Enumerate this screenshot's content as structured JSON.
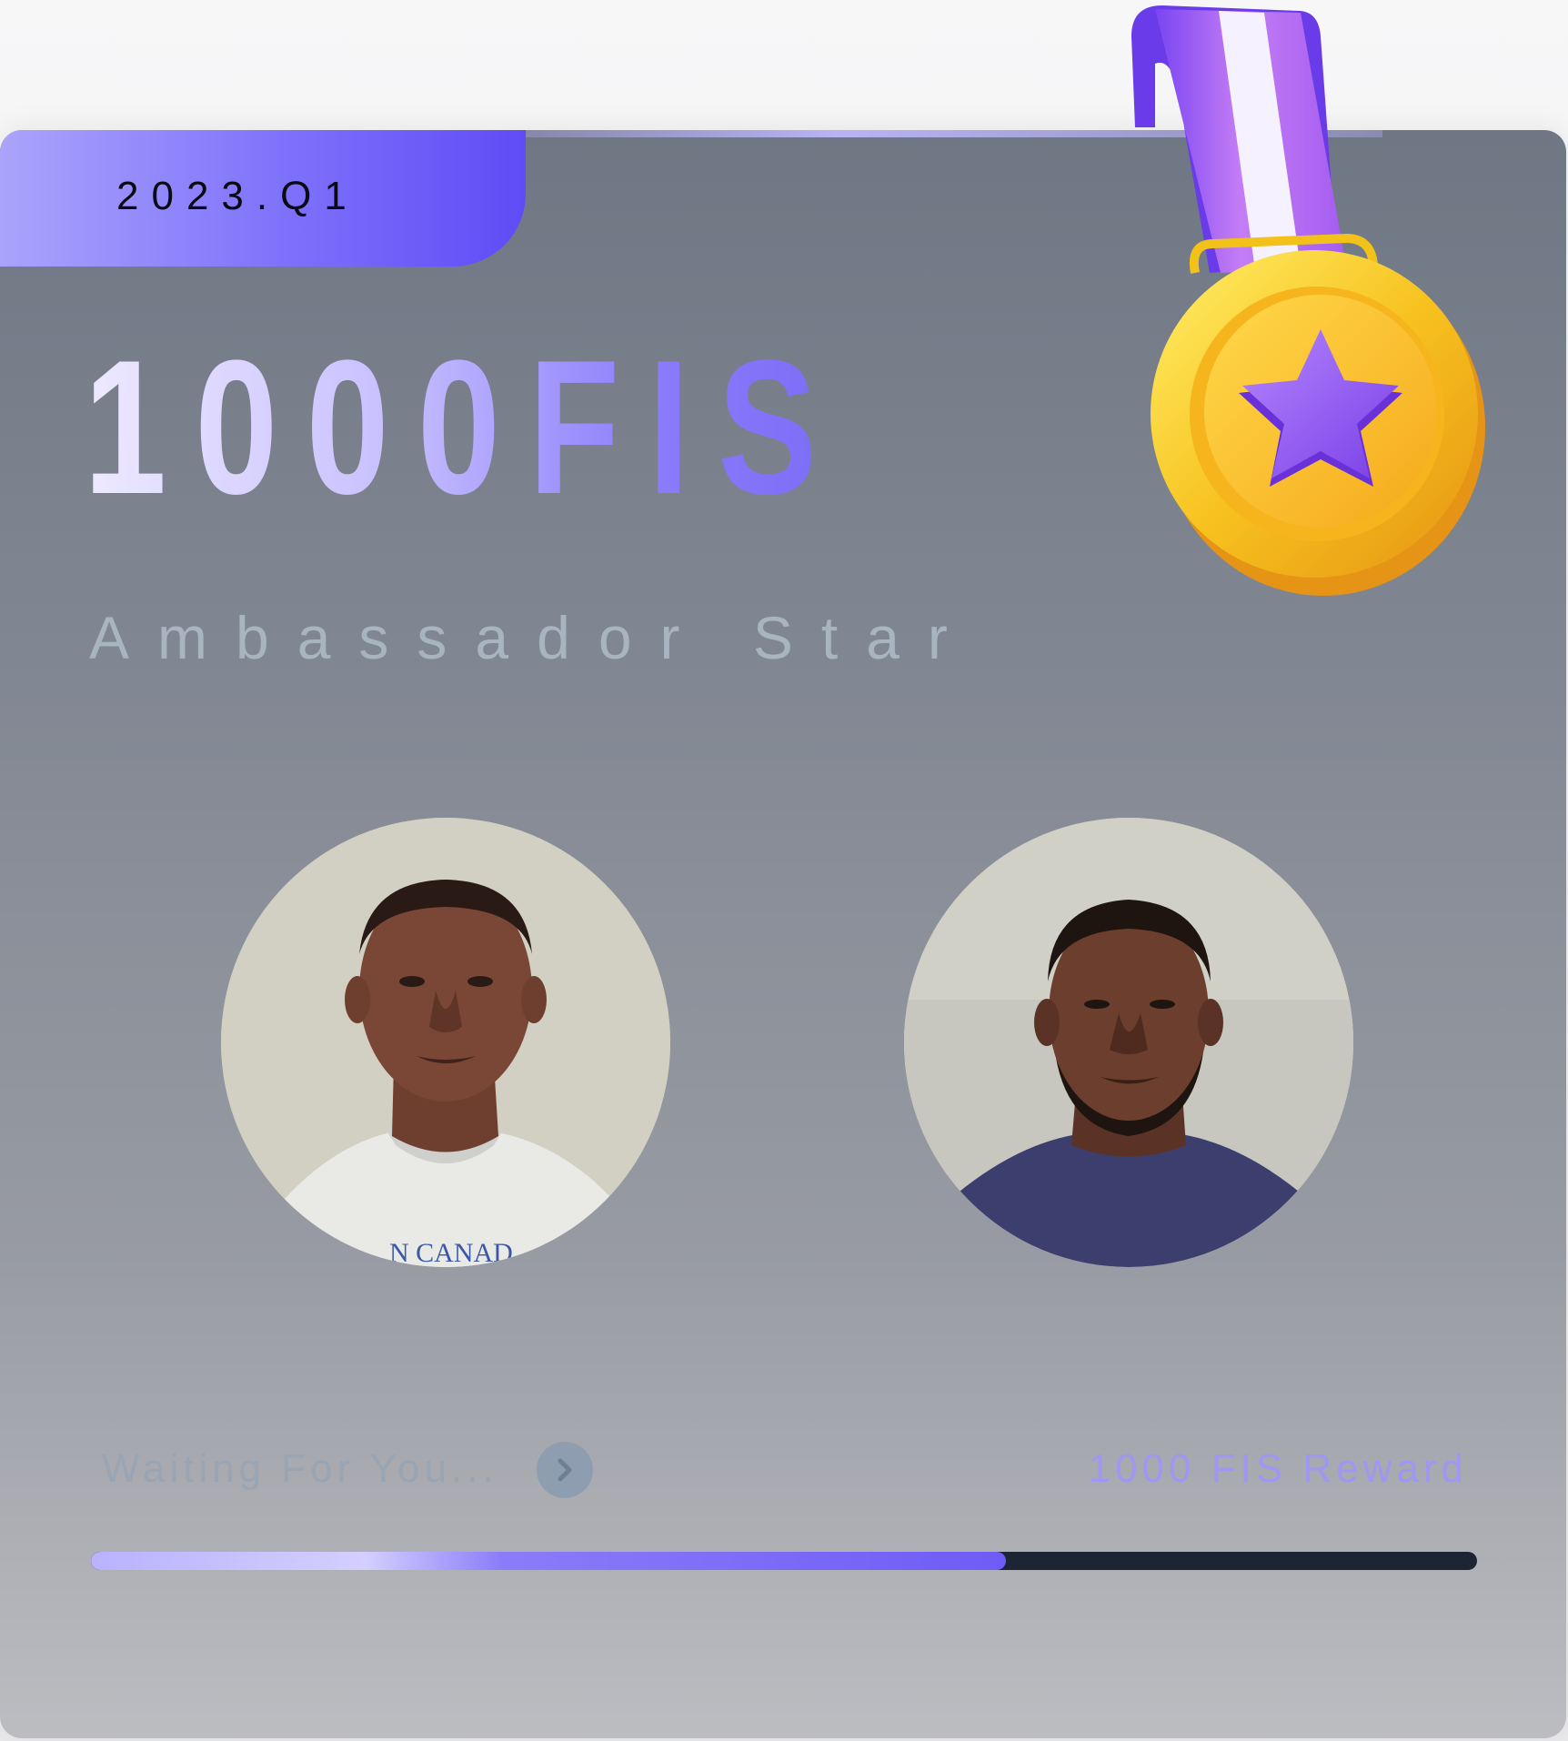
{
  "card": {
    "quarter": "2023.Q1",
    "headline": "1000FIS",
    "subtitle": "Ambassador Star"
  },
  "avatars": [
    {
      "name": "avatar-1"
    },
    {
      "name": "avatar-2"
    }
  ],
  "footer": {
    "waiting_label": "Waiting For You...",
    "reward_label": "1000 FIS Reward",
    "progress_percent": 66
  },
  "colors": {
    "accent": "#6e5cf6",
    "medal_gold": "#f7c21f",
    "medal_star": "#8d58f0"
  },
  "icons": {
    "go": "chevron-right-icon",
    "medal": "medal-star-icon"
  }
}
